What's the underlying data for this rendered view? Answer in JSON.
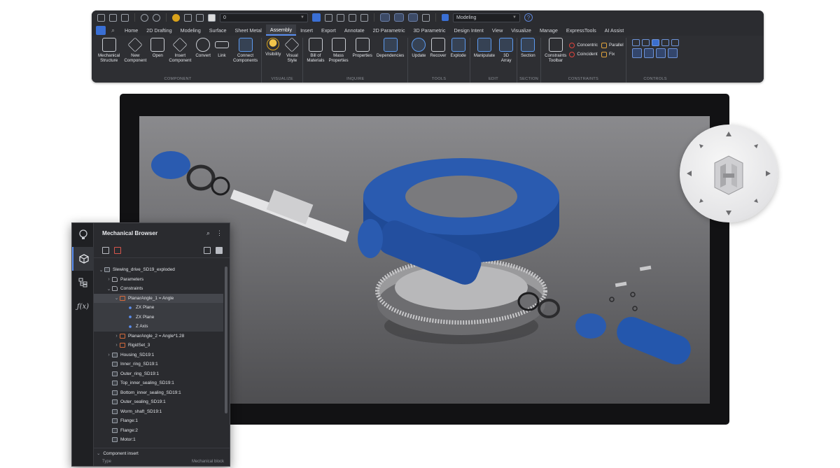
{
  "quick_access": {
    "layer_value": "0",
    "workspace": "Modeling"
  },
  "tabs": [
    "Home",
    "2D Drafting",
    "Modeling",
    "Surface",
    "Sheet Metal",
    "Assembly",
    "Insert",
    "Export",
    "Annotate",
    "2D Parametric",
    "3D Parametric",
    "Design Intent",
    "View",
    "Visualize",
    "Manage",
    "ExpressTools",
    "AI Assist"
  ],
  "active_tab": "Assembly",
  "ribbon": {
    "component": {
      "name": "COMPONENT",
      "tools": [
        "Mechanical\nStructure",
        "New\nComponent",
        "Open",
        "Insert\nComponent",
        "Convert",
        "Link",
        "Connect\nComponents"
      ]
    },
    "visualize": {
      "name": "VISUALIZE",
      "tools": [
        "Visibility",
        "Visual\nStyle"
      ]
    },
    "inquire": {
      "name": "INQUIRE",
      "tools": [
        "Bill of\nMaterials",
        "Mass\nProperties",
        "Properties",
        "Dependencies"
      ]
    },
    "tools": {
      "name": "TOOLS",
      "tools": [
        "Update",
        "Recover",
        "Explode"
      ]
    },
    "edit": {
      "name": "EDIT",
      "tools": [
        "Manipulate",
        "3D\nArray"
      ]
    },
    "section": {
      "name": "SECTION",
      "tools": [
        "Section"
      ]
    },
    "constraints": {
      "name": "CONSTRAINTS",
      "tools": [
        "Constraints\nToolbar"
      ],
      "small_tools": [
        "Concentric",
        "Coincident",
        "Parallel",
        "Fix"
      ]
    },
    "controls": {
      "name": "CONTROLS"
    }
  },
  "browser": {
    "title": "Mechanical Browser",
    "tree": [
      {
        "label": "Slewing_drive_SD19_exploded",
        "depth": 0,
        "twisty": "v",
        "icon": "part",
        "state": ""
      },
      {
        "label": "Parameters",
        "depth": 1,
        "twisty": ">",
        "icon": "folder",
        "state": ""
      },
      {
        "label": "Constraints",
        "depth": 1,
        "twisty": "v",
        "icon": "folder",
        "state": ""
      },
      {
        "label": "PlanarAngle_1 = Angle",
        "depth": 2,
        "twisty": "v",
        "icon": "cons",
        "state": "sel"
      },
      {
        "label": "ZX Plane",
        "depth": 3,
        "twisty": "",
        "icon": "plane",
        "state": "subsel"
      },
      {
        "label": "ZX Plane",
        "depth": 3,
        "twisty": "",
        "icon": "plane",
        "state": "subsel"
      },
      {
        "label": "Z Axis",
        "depth": 3,
        "twisty": "",
        "icon": "plane",
        "state": "subsel"
      },
      {
        "label": "PlanarAngle_2 = Angle*1.28",
        "depth": 2,
        "twisty": ">",
        "icon": "cons",
        "state": ""
      },
      {
        "label": "RigidSet_3",
        "depth": 2,
        "twisty": ">",
        "icon": "cons",
        "state": ""
      },
      {
        "label": "Housing_SD19:1",
        "depth": 1,
        "twisty": ">",
        "icon": "part",
        "state": ""
      },
      {
        "label": "Inner_ring_SD19:1",
        "depth": 1,
        "twisty": "",
        "icon": "part",
        "state": ""
      },
      {
        "label": "Outer_ring_SD19:1",
        "depth": 1,
        "twisty": "",
        "icon": "part",
        "state": ""
      },
      {
        "label": "Top_inner_sealing_SD19:1",
        "depth": 1,
        "twisty": "",
        "icon": "part",
        "state": ""
      },
      {
        "label": "Bottom_inner_sealing_SD19:1",
        "depth": 1,
        "twisty": "",
        "icon": "part",
        "state": ""
      },
      {
        "label": "Outer_sealing_SD19:1",
        "depth": 1,
        "twisty": "",
        "icon": "part",
        "state": ""
      },
      {
        "label": "Worm_shaft_SD19:1",
        "depth": 1,
        "twisty": "",
        "icon": "part",
        "state": ""
      },
      {
        "label": "Flange:1",
        "depth": 1,
        "twisty": "",
        "icon": "part",
        "state": ""
      },
      {
        "label": "Flange:2",
        "depth": 1,
        "twisty": "",
        "icon": "part",
        "state": ""
      },
      {
        "label": "Motor:1",
        "depth": 1,
        "twisty": "",
        "icon": "part",
        "state": ""
      }
    ],
    "footer_section": "Component insert",
    "footer_col1": "Type",
    "footer_col2": "Mechanical block"
  }
}
